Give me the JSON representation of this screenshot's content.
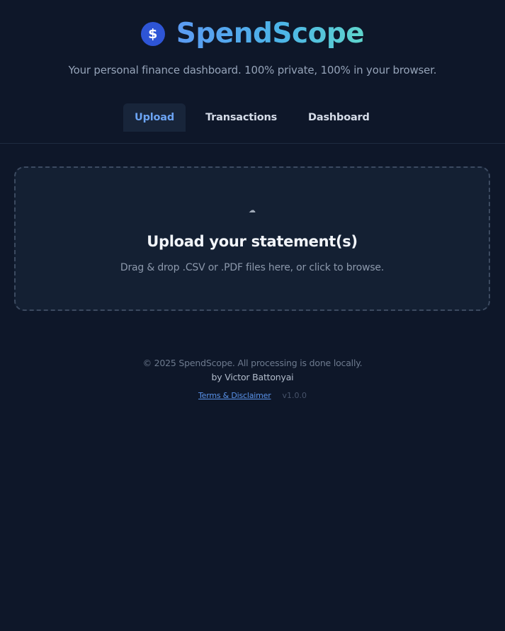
{
  "header": {
    "logo_symbol": "$",
    "logo_icon": "dollar-coin-icon",
    "title": "SpendScope",
    "tagline": "Your personal finance dashboard. 100% private, 100% in your browser."
  },
  "tabs": [
    {
      "label": "Upload",
      "active": true
    },
    {
      "label": "Transactions",
      "active": false
    },
    {
      "label": "Dashboard",
      "active": false
    }
  ],
  "upload": {
    "icon": "upload-icon",
    "icon_glyph": "☁",
    "title": "Upload your statement(s)",
    "subtitle": "Drag & drop .CSV or .PDF files here, or click to browse."
  },
  "footer": {
    "copyright": "© 2025 SpendScope. All processing is done locally.",
    "author": "by Victor Battonyai",
    "terms_link": "Terms & Disclaimer",
    "version": "v1.0.0"
  },
  "colors": {
    "background": "#0e1729",
    "accent": "#6ba3f2",
    "panel": "#142033",
    "logo": "#2e55d6"
  }
}
